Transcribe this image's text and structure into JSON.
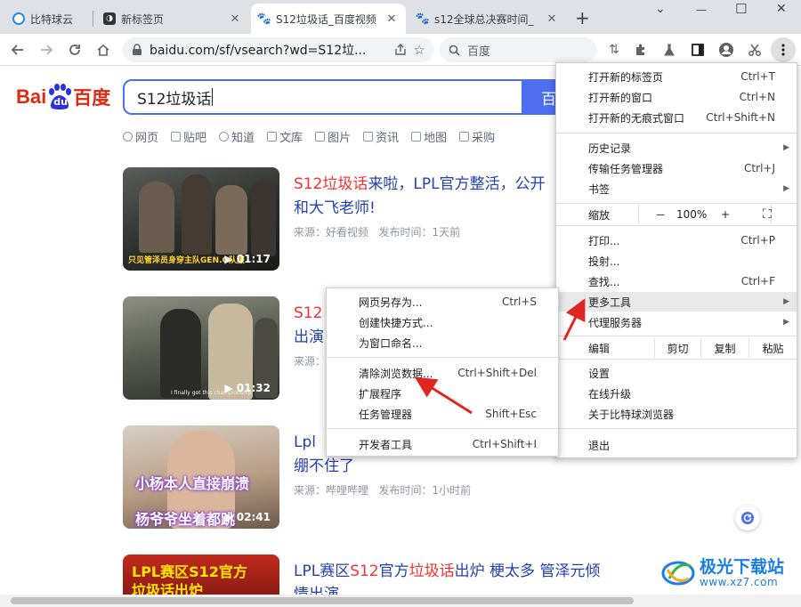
{
  "tabs": [
    {
      "title": "比特球云",
      "close": "",
      "active": false,
      "icon": "bitqiu-favicon"
    },
    {
      "title": "新标签页",
      "close": "✕",
      "active": false,
      "icon": "newtab-favicon"
    },
    {
      "title": "S12垃圾话_百度视频",
      "close": "✕",
      "active": true,
      "icon": "baidu-paw-favicon"
    },
    {
      "title": "s12全球总决赛时间_",
      "close": "✕",
      "active": false,
      "icon": "baidu-paw-favicon"
    }
  ],
  "new_tab_label": "+",
  "window_controls": {
    "chevron": "⌄",
    "minimize": "—",
    "maximize": "☐",
    "close": "✕"
  },
  "toolbar": {
    "url": "baidu.com/sf/vsearch?wd=S12垃...",
    "search_placeholder": "百度"
  },
  "baidu": {
    "logo_text_left": "Bai",
    "logo_text_paw": "du",
    "logo_text_right": "百度",
    "query": "S12垃圾话",
    "search_button": "百",
    "nav": [
      "网页",
      "贴吧",
      "知道",
      "文库",
      "图片",
      "资讯",
      "地图",
      "采购"
    ]
  },
  "results": [
    {
      "title_hl": "S12垃圾话",
      "title_rest": "来啦，LPL官方整活，公开",
      "title_line2": "和大飞老师!",
      "meta_source": "来源：好看视频",
      "meta_time": "发布时间：1天前",
      "duration": "01:17",
      "caption": "只见管泽员身穿主队GEN.G队服"
    },
    {
      "title_hl": "S12",
      "title_rest": "",
      "title_line2": "出演",
      "meta_source": "来源：",
      "meta_time": "",
      "duration": "01:32",
      "caption": "I finally got this championship"
    },
    {
      "title_hl": "",
      "title_rest": "Lpl",
      "title_line2": "绷不住了",
      "meta_source": "来源：哔哩哔哩",
      "meta_time": "发布时间：1小时前",
      "duration": "02:41",
      "caption_top": "小杨本人直接崩溃",
      "caption_bottom": "杨爷爷坐着都跳"
    },
    {
      "title_pre": "LPL赛区",
      "title_hl": "S12",
      "title_mid": "官方",
      "title_hl2": "垃圾话",
      "title_rest": "出炉 梗太多 管泽元倾",
      "title_line2": "情出演",
      "thumb_text_1": "LPL赛区S12官方",
      "thumb_text_2": "垃圾话出炉"
    }
  ],
  "main_menu": {
    "items_group1": [
      {
        "label": "打开新的标签页",
        "shortcut": "Ctrl+T"
      },
      {
        "label": "打开新的窗口",
        "shortcut": "Ctrl+N"
      },
      {
        "label": "打开新的无痕式窗口",
        "shortcut": "Ctrl+Shift+N"
      }
    ],
    "items_group2": [
      {
        "label": "历史记录",
        "shortcut": "",
        "arrow": "▶"
      },
      {
        "label": "传输任务管理器",
        "shortcut": "Ctrl+J",
        "arrow": ""
      },
      {
        "label": "书签",
        "shortcut": "",
        "arrow": "▶"
      }
    ],
    "zoom": {
      "label": "缩放",
      "minus": "－",
      "value": "100%",
      "plus": "+",
      "fullscreen": "⛶"
    },
    "items_group3": [
      {
        "label": "打印...",
        "shortcut": "Ctrl+P",
        "arrow": ""
      },
      {
        "label": "投射...",
        "shortcut": "",
        "arrow": ""
      },
      {
        "label": "查找...",
        "shortcut": "Ctrl+F",
        "arrow": ""
      },
      {
        "label": "更多工具",
        "shortcut": "",
        "arrow": "▶"
      },
      {
        "label": "代理服务器",
        "shortcut": "",
        "arrow": "▶"
      }
    ],
    "edit": {
      "label": "编辑",
      "cut": "剪切",
      "copy": "复制",
      "paste": "粘贴"
    },
    "items_group4": [
      {
        "label": "设置"
      },
      {
        "label": "在线升级"
      },
      {
        "label": "关于比特球浏览器"
      }
    ],
    "exit": "退出"
  },
  "sub_menu": {
    "group1": [
      {
        "label": "网页另存为...",
        "shortcut": "Ctrl+S"
      },
      {
        "label": "创建快捷方式...",
        "shortcut": ""
      },
      {
        "label": "为窗口命名...",
        "shortcut": ""
      }
    ],
    "group2": [
      {
        "label": "清除浏览数据...",
        "shortcut": "Ctrl+Shift+Del"
      },
      {
        "label": "扩展程序",
        "shortcut": ""
      },
      {
        "label": "任务管理器",
        "shortcut": "Shift+Esc"
      }
    ],
    "group3": [
      {
        "label": "开发者工具",
        "shortcut": "Ctrl+Shift+I"
      }
    ]
  },
  "watermark": {
    "line1": "极光下载站",
    "line2": "www.xz7.com"
  },
  "colors": {
    "accent": "#4e6ef2",
    "highlight": "#f73131",
    "link": "#2440b3",
    "annotation_arrow": "#e0261f"
  }
}
